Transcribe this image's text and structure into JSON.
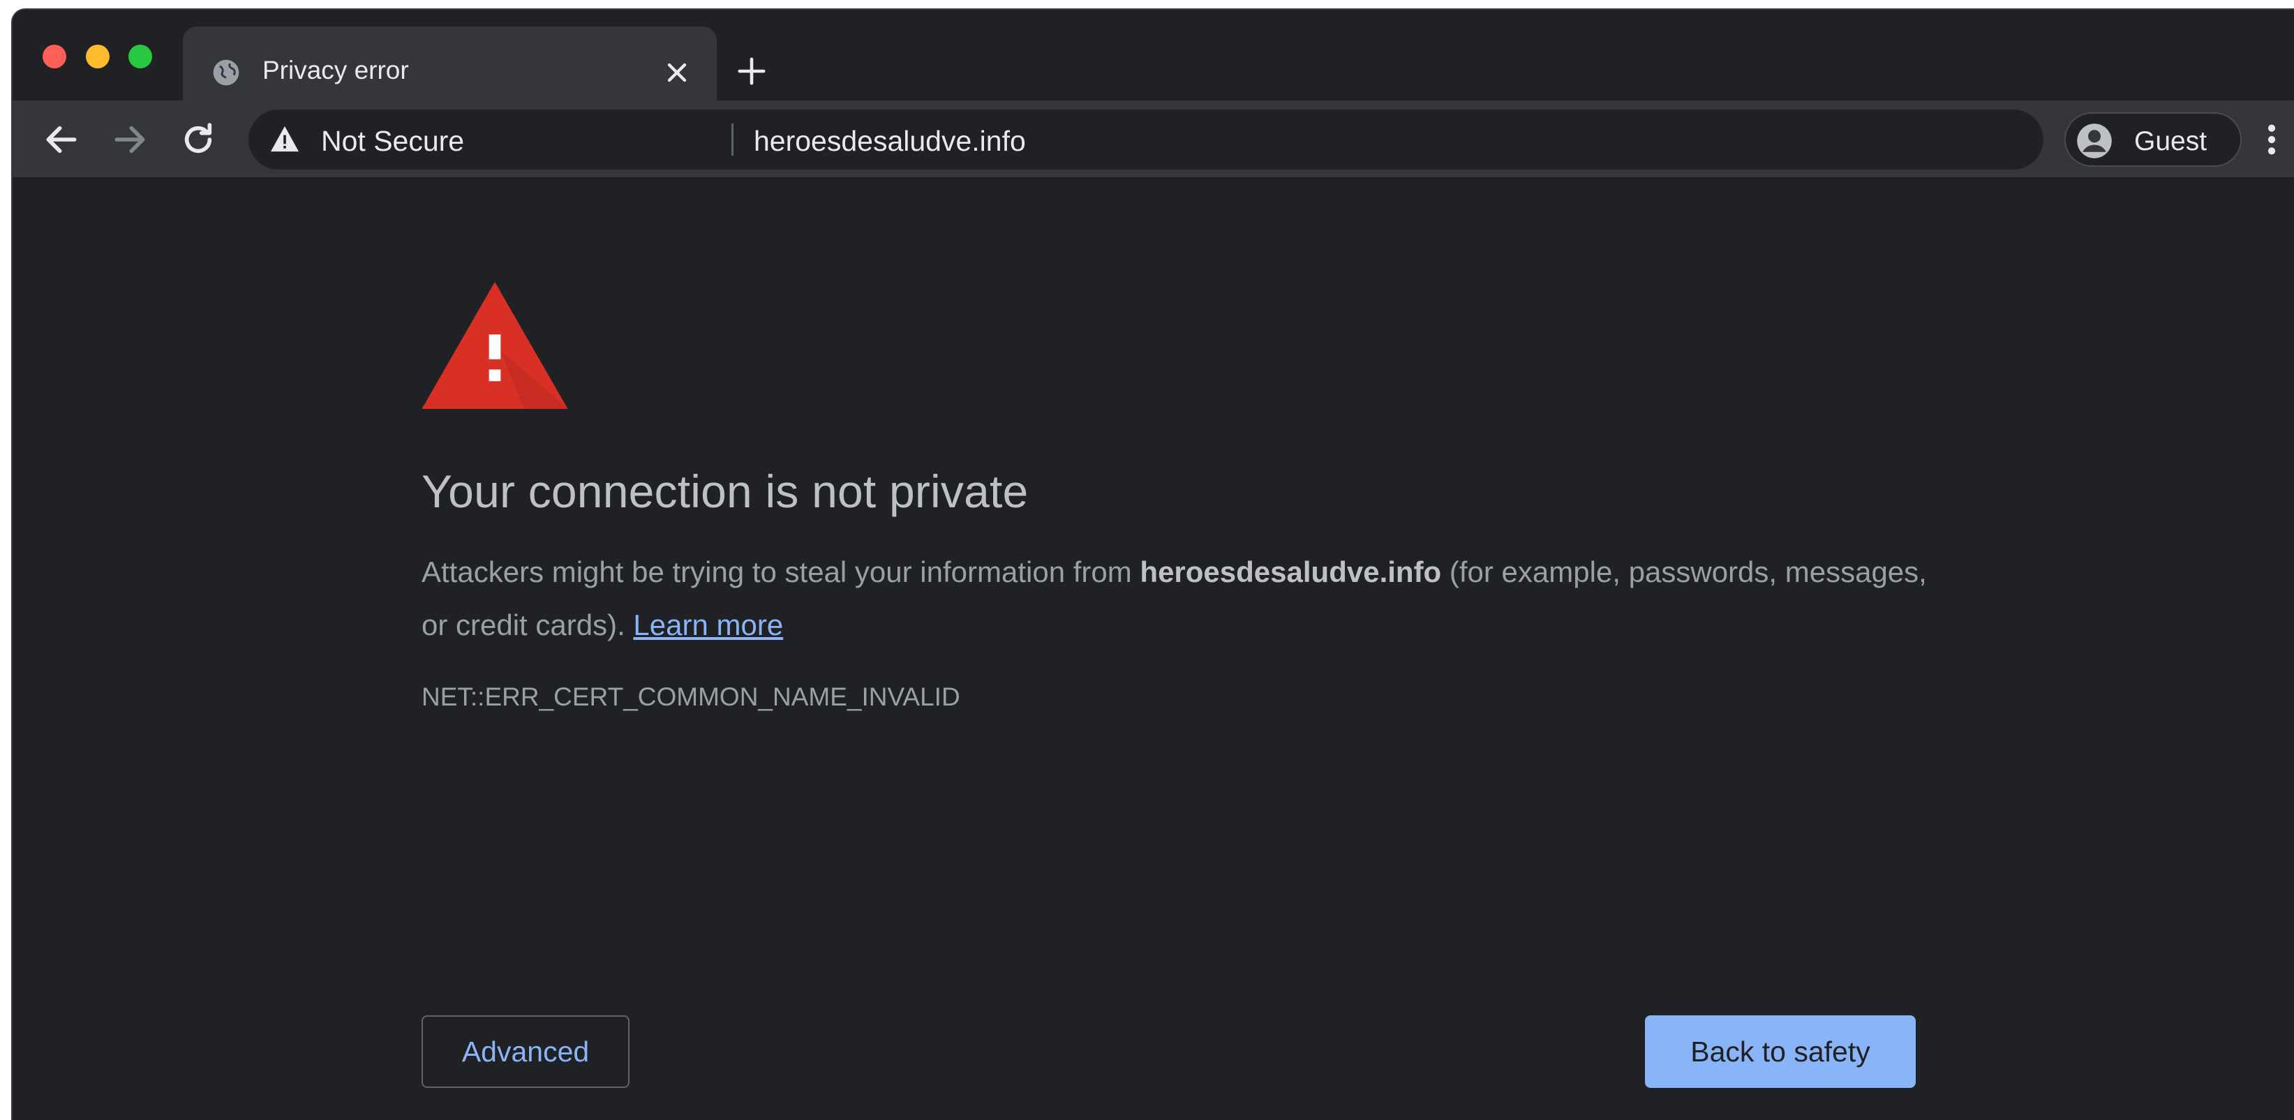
{
  "window": {
    "controls": [
      "close",
      "minimize",
      "zoom"
    ]
  },
  "tab": {
    "title": "Privacy error",
    "favicon": "globe-icon",
    "close_icon": "close-icon",
    "new_tab_icon": "plus-icon"
  },
  "toolbar": {
    "back_icon": "arrow-left-icon",
    "forward_icon": "arrow-right-icon",
    "reload_icon": "reload-icon",
    "security_icon": "warning-triangle-icon",
    "security_label": "Not Secure",
    "url": "heroesdesaludve.info",
    "profile_icon": "account-circle-icon",
    "profile_label": "Guest",
    "menu_icon": "more-vert-icon"
  },
  "page": {
    "icon": "red-warning-triangle-icon",
    "headline": "Your connection is not private",
    "explanation_prefix": "Attackers might be trying to steal your information from ",
    "explanation_domain": "heroesdesaludve.info",
    "explanation_suffix": " (for example, passwords, messages, or credit cards). ",
    "learn_more": "Learn more",
    "error_code": "NET::ERR_CERT_COMMON_NAME_INVALID",
    "advanced_button": "Advanced",
    "back_button": "Back to safety"
  },
  "colors": {
    "background": "#202124",
    "toolbar": "#35363a",
    "headline": "#bdc1c6",
    "body_text": "#9aa0a6",
    "link": "#8ab4f8",
    "primary_button": "#8ab4f8",
    "warning_red": "#d93025"
  }
}
